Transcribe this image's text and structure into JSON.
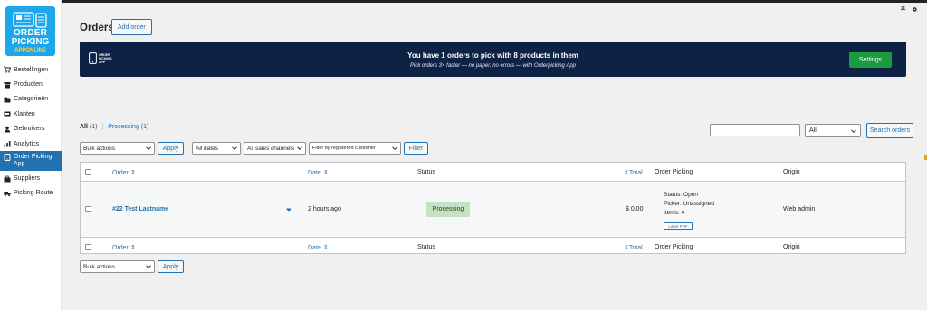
{
  "logo": {
    "line1": "ORDER",
    "line2": "PICKING",
    "line3a": "APP",
    "line3b": "ONLINE"
  },
  "sidebar": {
    "items": [
      {
        "label": "Bestellingen",
        "icon": "cart-icon"
      },
      {
        "label": "Producten",
        "icon": "archive-icon"
      },
      {
        "label": "Categorieën",
        "icon": "folder-icon"
      },
      {
        "label": "Klanten",
        "icon": "users-icon"
      },
      {
        "label": "Gebruikers",
        "icon": "user-icon"
      },
      {
        "label": "Analytics",
        "icon": "bar-chart-icon"
      },
      {
        "label": "Order Picking App",
        "icon": "tablet-icon",
        "active": true
      },
      {
        "label": "Suppliers",
        "icon": "briefcase-icon"
      },
      {
        "label": "Picking Route",
        "icon": "truck-icon"
      }
    ]
  },
  "header": {
    "title": "Orders",
    "add_order_label": "Add order"
  },
  "banner": {
    "logo_text": "ORDER PICKING APP",
    "title": "You have 1 orders to pick with 8 products in them",
    "subtitle": "Pick orders 3× faster — no paper, no errors — with Orderpicking App",
    "button_label": "Settings"
  },
  "subsubsub": {
    "all_label": "All",
    "all_count": "(1)",
    "separator": "|",
    "processing_label": "Processing",
    "processing_count": "(1)"
  },
  "search": {
    "input_value": "",
    "select_value": "All",
    "button_label": "Search orders"
  },
  "filters": {
    "bulk_actions": "Bulk actions",
    "apply_label": "Apply",
    "dates": "All dates",
    "channels": "All sales channels",
    "customer_placeholder": "Filter by registered customer",
    "filter_label": "Filter"
  },
  "table": {
    "columns": {
      "order": "Order",
      "date": "Date",
      "status": "Status",
      "total": "Total",
      "order_picking": "Order Picking",
      "origin": "Origin"
    },
    "rows": [
      {
        "order": "#22 Test Lastname",
        "date": "2 hours ago",
        "status": "Processing",
        "total": "$ 0,00",
        "picking_status": "Status: Open",
        "picking_picker": "Picker: Unassigned",
        "picking_items": "Items: 4",
        "label_pdf": "Label PDF",
        "origin": "Web admin"
      }
    ]
  },
  "bottom": {
    "bulk_actions": "Bulk actions",
    "apply_label": "Apply"
  },
  "colors": {
    "accent": "#2271b1",
    "banner_bg": "#0d2245",
    "settings_green": "#1a9b3f",
    "status_processing_bg": "#c6e1c6",
    "status_processing_text": "#2c4700",
    "active_menu_bg": "#2271b1",
    "logo_bg": "#1ea6ea"
  }
}
